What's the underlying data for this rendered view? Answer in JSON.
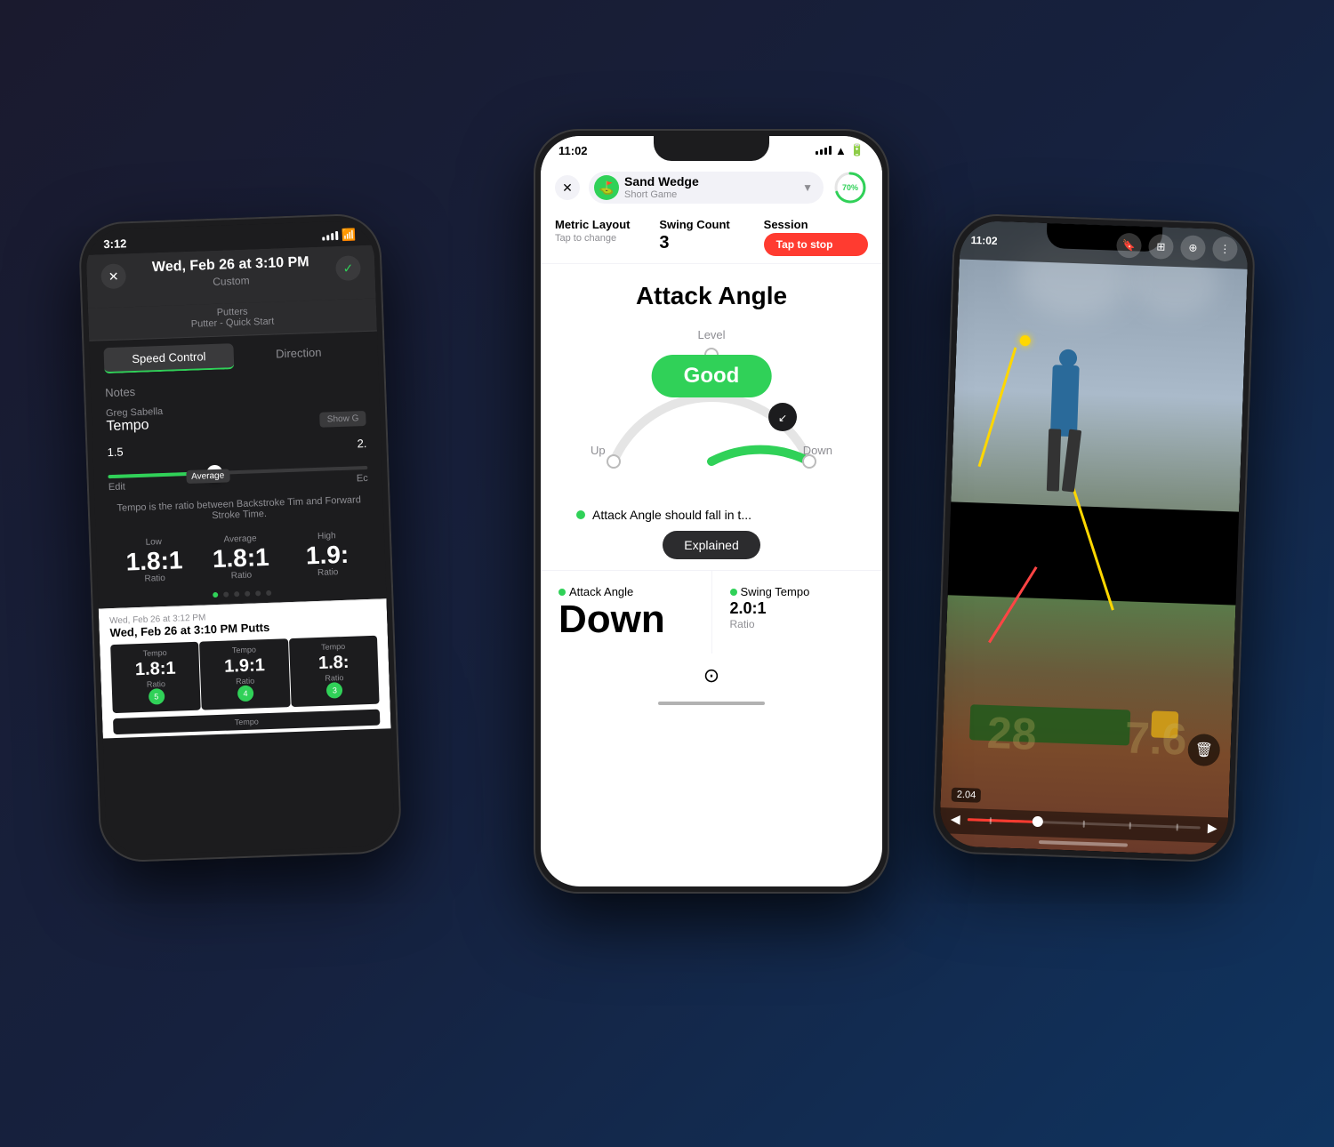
{
  "phones": {
    "left": {
      "status_time": "3:12",
      "header_date": "Wed, Feb 26 at 3:10 PM",
      "header_sub": "Custom",
      "nav_text1": "Putters",
      "nav_text2": "Putter - Quick Start",
      "tab_speed": "Speed Control",
      "tab_direction": "Direction",
      "section_notes": "Notes",
      "coach_name": "Greg Sabella",
      "metric_name": "Tempo",
      "show_btn": "Show G",
      "avg_label": "Average",
      "slider_left": "1.5",
      "slider_right": "2.",
      "slider_left_label": "Edit",
      "slider_right_label": "Ec",
      "description": "Tempo is the ratio between Backstroke Tim and Forward Stroke Time.",
      "low_label": "Low",
      "avg_stat_label": "Average",
      "high_label": "High",
      "low_value": "1.8:1",
      "avg_value": "1.8:1",
      "high_value": "1.9:",
      "low_unit": "Ratio",
      "avg_unit": "Ratio",
      "high_unit": "Ratio",
      "history_date": "Wed, Feb 26 at 3:12 PM",
      "history_title": "Wed, Feb 26 at 3:10 PM Putts",
      "history_cells": [
        {
          "label": "Tempo",
          "value": "1.8:1",
          "unit": "Ratio",
          "badge": "5"
        },
        {
          "label": "Tempo",
          "value": "1.9:1",
          "unit": "Ratio",
          "badge": "4"
        },
        {
          "label": "Tempo",
          "value": "1.8:",
          "unit": "Ratio",
          "badge": "3"
        }
      ],
      "history_extra_label": "Tempo"
    },
    "center": {
      "status_time": "11:02",
      "close_btn": "✕",
      "club_name": "Sand Wedge",
      "club_type": "Short Game",
      "battery_pct": "70%",
      "metric_layout_label": "Metric Layout",
      "tap_to_change": "Tap to change",
      "swing_count_label": "Swing Count",
      "swing_count_value": "3",
      "session_label": "Session",
      "tap_to_stop": "Tap to stop",
      "attack_title": "Attack Angle",
      "gauge_up": "Up",
      "gauge_down": "Down",
      "gauge_level": "Level",
      "good_label": "Good",
      "info_text": "Attack Angle should fall in t...",
      "explained_btn": "Explained",
      "bottom_metric1_label": "Attack Angle",
      "bottom_metric1_value": "Down",
      "bottom_metric2_label": "Swing Tempo",
      "bottom_metric2_value": "2.0:1",
      "bottom_metric2_sub": "Ratio"
    },
    "right": {
      "status_time": "11:02",
      "speed_tag": "2.04",
      "watermark_1": "28",
      "watermark_2": "7.6"
    }
  }
}
